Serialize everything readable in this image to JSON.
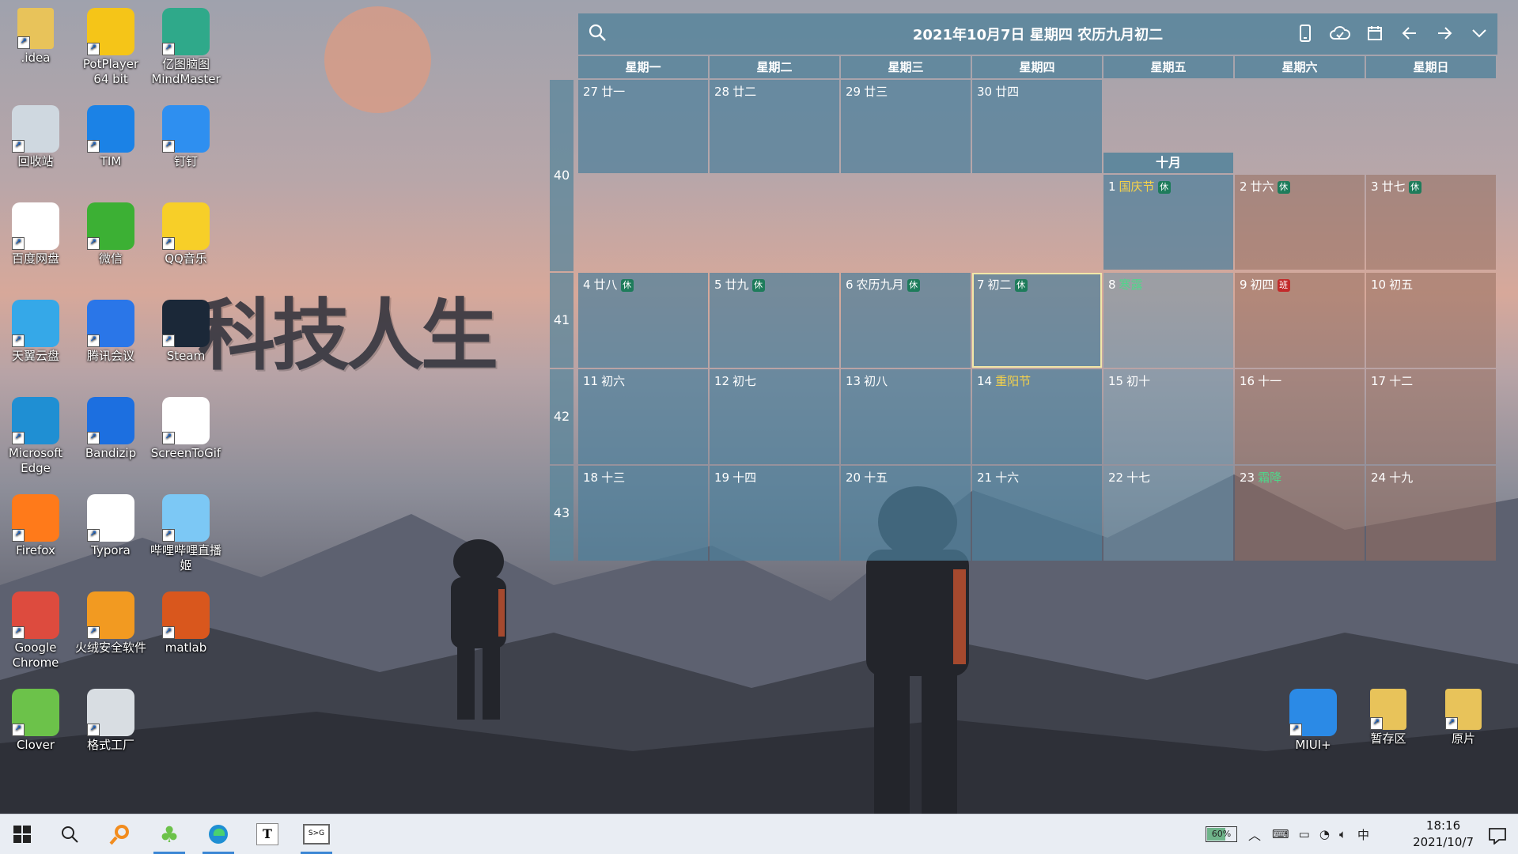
{
  "desktop": {
    "watermark": "科技人生",
    "icons": [
      {
        "label": ".idea",
        "icon": "folder-icon",
        "color": "#e8c35a"
      },
      {
        "label": "PotPlayer 64 bit",
        "icon": "potplayer-icon",
        "color": "#f5c518"
      },
      {
        "label": "亿图脑图MindMaster",
        "icon": "mindmaster-icon",
        "color": "#2fa98a"
      },
      {
        "label": "回收站",
        "icon": "recycle-bin-icon",
        "color": "#cfd8e0"
      },
      {
        "label": "TIM",
        "icon": "tim-icon",
        "color": "#1b82e6"
      },
      {
        "label": "钉钉",
        "icon": "dingtalk-icon",
        "color": "#2e8ff0"
      },
      {
        "label": "百度网盘",
        "icon": "baidu-netdisk-icon",
        "color": "#ffffff"
      },
      {
        "label": "微信",
        "icon": "wechat-icon",
        "color": "#3cb034"
      },
      {
        "label": "QQ音乐",
        "icon": "qqmusic-icon",
        "color": "#f7cf28"
      },
      {
        "label": "天翼云盘",
        "icon": "tianyi-cloud-icon",
        "color": "#35a8e8"
      },
      {
        "label": "腾讯会议",
        "icon": "tencent-meeting-icon",
        "color": "#2a76e8"
      },
      {
        "label": "Steam",
        "icon": "steam-icon",
        "color": "#1b2838"
      },
      {
        "label": "Microsoft Edge",
        "icon": "edge-icon",
        "color": "#1f8fd3"
      },
      {
        "label": "Bandizip",
        "icon": "bandizip-icon",
        "color": "#1c6fe0"
      },
      {
        "label": "ScreenToGif",
        "icon": "screentogif-icon",
        "color": "#ffffff"
      },
      {
        "label": "Firefox",
        "icon": "firefox-icon",
        "color": "#ff7a1a"
      },
      {
        "label": "Typora",
        "icon": "typora-icon",
        "color": "#ffffff"
      },
      {
        "label": "哔哩哔哩直播姬",
        "icon": "bilibili-live-icon",
        "color": "#7cc8f5"
      },
      {
        "label": "Google Chrome",
        "icon": "chrome-icon",
        "color": "#dd4b3e"
      },
      {
        "label": "火绒安全软件",
        "icon": "huorong-icon",
        "color": "#f29a21"
      },
      {
        "label": "matlab",
        "icon": "matlab-icon",
        "color": "#d9571d"
      },
      {
        "label": "Clover",
        "icon": "clover-icon",
        "color": "#6cc24a"
      },
      {
        "label": "格式工厂",
        "icon": "format-factory-icon",
        "color": "#d8dde2"
      },
      {
        "label": "MIUI+",
        "icon": "miui-plus-icon",
        "color": "#2b8ae6"
      },
      {
        "label": "暂存区",
        "icon": "folder-icon",
        "color": "#e8c35a"
      },
      {
        "label": "原片",
        "icon": "folder-icon",
        "color": "#e8c35a"
      }
    ]
  },
  "calendar": {
    "title": "2021年10月7日 星期四 农历九月初二",
    "weekdays": [
      "星期一",
      "星期二",
      "星期三",
      "星期四",
      "星期五",
      "星期六",
      "星期日"
    ],
    "month_header": "十月",
    "week_numbers": [
      "40",
      "41",
      "42",
      "43"
    ],
    "tags": {
      "rest": "休",
      "work": "班"
    },
    "days": [
      {
        "d": "27",
        "s": "廿一"
      },
      {
        "d": "28",
        "s": "廿二"
      },
      {
        "d": "29",
        "s": "廿三"
      },
      {
        "d": "30",
        "s": "廿四"
      },
      {
        "d": "1",
        "s": "国庆节",
        "kind": "fest",
        "tag": "rest"
      },
      {
        "d": "2",
        "s": "廿六",
        "tag": "rest"
      },
      {
        "d": "3",
        "s": "廿七",
        "tag": "rest"
      },
      {
        "d": "4",
        "s": "廿八",
        "tag": "rest"
      },
      {
        "d": "5",
        "s": "廿九",
        "tag": "rest"
      },
      {
        "d": "6",
        "s": "农历九月",
        "tag": "rest"
      },
      {
        "d": "7",
        "s": "初二",
        "tag": "rest",
        "today": true
      },
      {
        "d": "8",
        "s": "寒露",
        "kind": "term"
      },
      {
        "d": "9",
        "s": "初四",
        "tag": "work"
      },
      {
        "d": "10",
        "s": "初五"
      },
      {
        "d": "11",
        "s": "初六"
      },
      {
        "d": "12",
        "s": "初七"
      },
      {
        "d": "13",
        "s": "初八"
      },
      {
        "d": "14",
        "s": "重阳节",
        "kind": "fest"
      },
      {
        "d": "15",
        "s": "初十"
      },
      {
        "d": "16",
        "s": "十一"
      },
      {
        "d": "17",
        "s": "十二"
      },
      {
        "d": "18",
        "s": "十三"
      },
      {
        "d": "19",
        "s": "十四"
      },
      {
        "d": "20",
        "s": "十五"
      },
      {
        "d": "21",
        "s": "十六"
      },
      {
        "d": "22",
        "s": "十七"
      },
      {
        "d": "23",
        "s": "霜降",
        "kind": "term"
      },
      {
        "d": "24",
        "s": "十九"
      }
    ]
  },
  "taskbar": {
    "apps": [
      "windows-start-icon",
      "search-icon",
      "everything-search-icon",
      "clover-icon",
      "edge-icon",
      "typora-icon",
      "screentogif-icon"
    ],
    "battery": "60%",
    "ime": "中",
    "time": "18:16",
    "date": "2021/10/7"
  }
}
